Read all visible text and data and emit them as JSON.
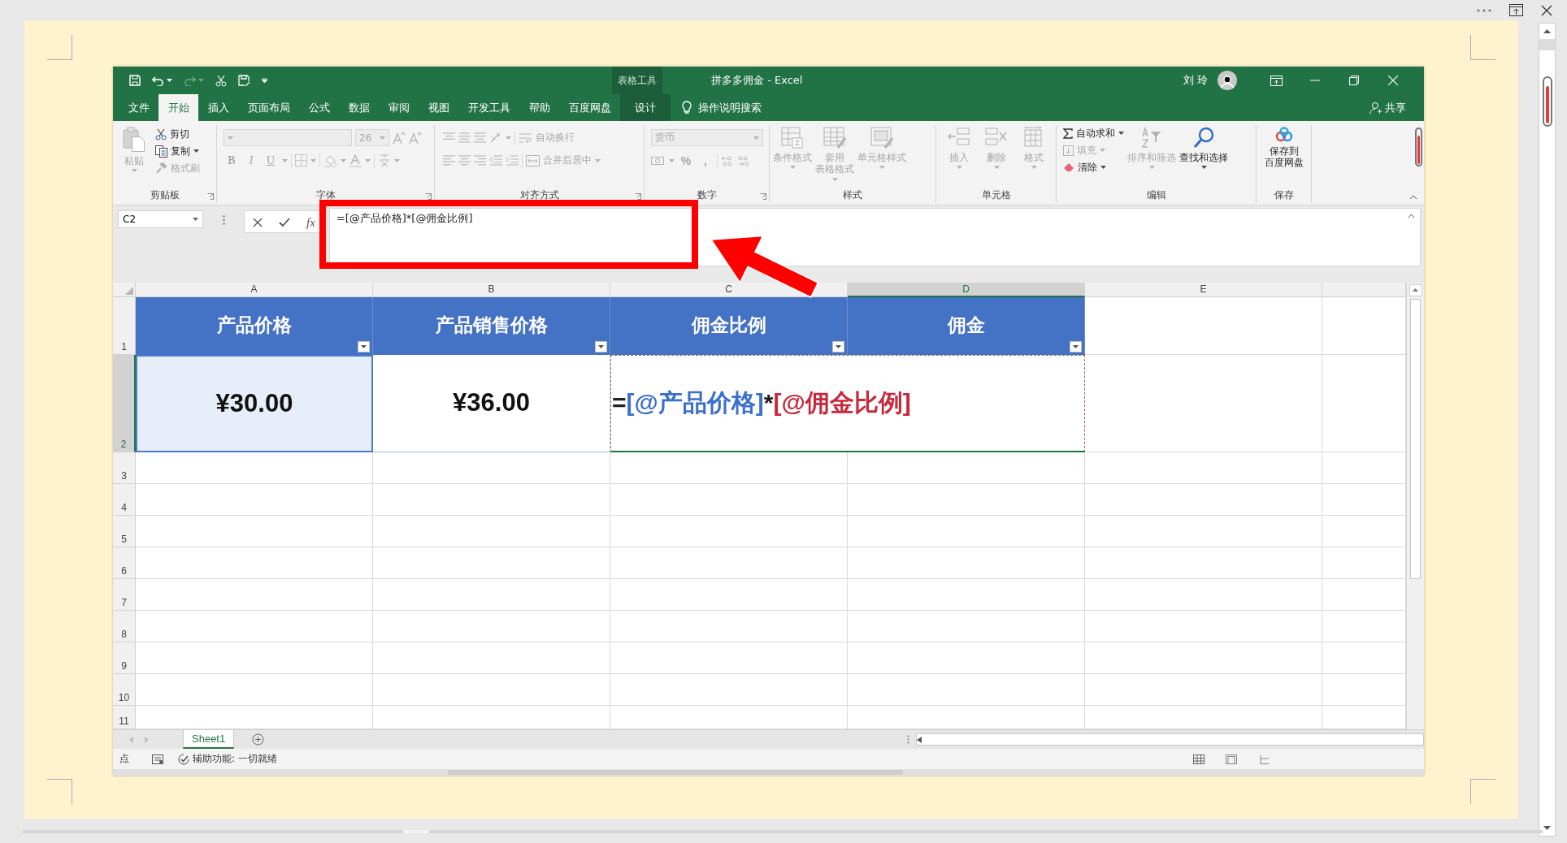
{
  "window": {
    "context_label": "表格工具",
    "title": "拼多多佣金 - Excel",
    "user": "刘 玲"
  },
  "tabs": [
    {
      "label": "文件",
      "selected": false,
      "kind": "normal"
    },
    {
      "label": "开始",
      "selected": true,
      "kind": "normal"
    },
    {
      "label": "插入",
      "selected": false,
      "kind": "normal"
    },
    {
      "label": "页面布局",
      "selected": false,
      "kind": "normal"
    },
    {
      "label": "公式",
      "selected": false,
      "kind": "normal"
    },
    {
      "label": "数据",
      "selected": false,
      "kind": "normal"
    },
    {
      "label": "审阅",
      "selected": false,
      "kind": "normal"
    },
    {
      "label": "视图",
      "selected": false,
      "kind": "normal"
    },
    {
      "label": "开发工具",
      "selected": false,
      "kind": "normal"
    },
    {
      "label": "帮助",
      "selected": false,
      "kind": "normal"
    },
    {
      "label": "百度网盘",
      "selected": false,
      "kind": "normal"
    },
    {
      "label": "设计",
      "selected": false,
      "kind": "contextual"
    }
  ],
  "search": {
    "placeholder": "操作说明搜索"
  },
  "share": {
    "label": "共享"
  },
  "ribbon": [
    {
      "kind": "clipboard",
      "label": "剪贴板",
      "items": [
        {
          "label": "粘贴",
          "disabled": true
        },
        {
          "label": "剪切",
          "disabled": false
        },
        {
          "label": "复制",
          "disabled": false
        },
        {
          "label": "格式刷",
          "disabled": true
        }
      ]
    },
    {
      "kind": "font",
      "label": "字体",
      "disabled": true,
      "font_size": "26",
      "items": [
        {
          "label": "B"
        },
        {
          "label": "I"
        },
        {
          "label": "U"
        }
      ]
    },
    {
      "kind": "alignment",
      "label": "对齐方式",
      "disabled": true,
      "items": [
        {
          "label": "自动换行"
        },
        {
          "label": "合并后居中"
        }
      ]
    },
    {
      "kind": "number",
      "label": "数字",
      "disabled": true,
      "format": "货币",
      "items": [
        {
          "label": "%"
        },
        {
          "label": ","
        }
      ]
    },
    {
      "kind": "styles",
      "label": "样式",
      "disabled": true,
      "items": [
        {
          "label": "条件格式"
        },
        {
          "lines": [
            "套用",
            "表格格式"
          ]
        },
        {
          "label": "单元格样式"
        }
      ]
    },
    {
      "kind": "cells",
      "label": "单元格",
      "disabled": true,
      "items": [
        {
          "label": "插入"
        },
        {
          "label": "删除"
        },
        {
          "label": "格式"
        }
      ]
    },
    {
      "kind": "editing",
      "label": "编辑",
      "items": [
        {
          "label": "自动求和",
          "disabled": false
        },
        {
          "label": "填充",
          "disabled": true
        },
        {
          "label": "清除",
          "disabled": false
        },
        {
          "label": "排序和筛选",
          "disabled": true
        },
        {
          "label": "查找和选择",
          "disabled": false
        }
      ]
    },
    {
      "kind": "save",
      "label": "保存",
      "items": [
        {
          "lines": [
            "保存到",
            "百度网盘"
          ],
          "disabled": false
        }
      ]
    }
  ],
  "formula_bar": {
    "name_box": "C2",
    "function_label": "fx",
    "formula": "=[@产品价格]*[@佣金比例]"
  },
  "sheet": {
    "columns": [
      {
        "label": "A",
        "selected": false
      },
      {
        "label": "B",
        "selected": false
      },
      {
        "label": "C",
        "selected": false
      },
      {
        "label": "D",
        "selected": true
      },
      {
        "label": "E",
        "selected": false
      }
    ],
    "rows": [
      {
        "label": "1",
        "selected": false
      },
      {
        "label": "2",
        "selected": true
      },
      {
        "label": "3",
        "selected": false
      },
      {
        "label": "4",
        "selected": false
      },
      {
        "label": "5",
        "selected": false
      },
      {
        "label": "6",
        "selected": false
      },
      {
        "label": "7",
        "selected": false
      },
      {
        "label": "8",
        "selected": false
      },
      {
        "label": "9",
        "selected": false
      },
      {
        "label": "10",
        "selected": false
      },
      {
        "label": "11",
        "selected": false
      }
    ],
    "table": {
      "headers": [
        "产品价格",
        "产品销售价格",
        "佣金比例",
        "佣金"
      ],
      "values": [
        {
          "text": "¥30.00",
          "highlighted": true
        },
        {
          "text": "¥36.00",
          "highlighted": false
        }
      ],
      "editing_formula": [
        {
          "text": "=",
          "color": "#222222"
        },
        {
          "text": "[@产品价格]",
          "color": "#3b6fcd"
        },
        {
          "text": "*",
          "color": "#1a1a1a"
        },
        {
          "text": "[@佣金比例]",
          "color": "#c8283c"
        }
      ]
    }
  },
  "sheet_tabs": [
    {
      "label": "Sheet1",
      "selected": true
    }
  ],
  "status_bar": {
    "mode": "点",
    "accessibility": "辅助功能: 一切就绪"
  }
}
